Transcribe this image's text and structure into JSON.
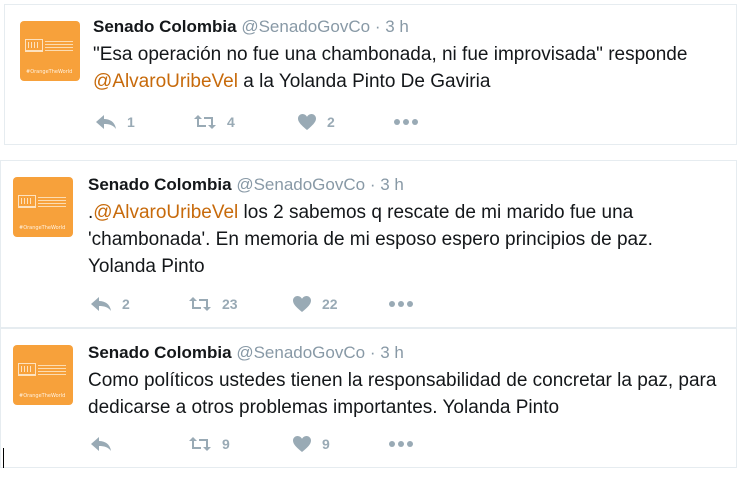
{
  "tweets": [
    {
      "name": "Senado Colombia",
      "handle": "@SenadoGovCo",
      "separator": "·",
      "time": "3 h",
      "avatar_tag": "#OrangeTheWorld",
      "text_before": "\"Esa operación no fue una chambonada, ni fue improvisada\" responde ",
      "mention": "@AlvaroUribeVel",
      "text_after": " a la  Yolanda Pinto De Gaviria",
      "replies": "1",
      "retweets": "4",
      "likes": "2"
    },
    {
      "name": "Senado Colombia",
      "handle": "@SenadoGovCo",
      "separator": "·",
      "time": "3 h",
      "avatar_tag": "#OrangeTheWorld",
      "text_before": ".",
      "mention": "@AlvaroUribeVel",
      "text_after": " los 2 sabemos q rescate de mi marido fue una 'chambonada'. En memoria de mi esposo espero principios de paz. Yolanda Pinto",
      "replies": "2",
      "retweets": "23",
      "likes": "22"
    },
    {
      "name": "Senado Colombia",
      "handle": "@SenadoGovCo",
      "separator": "·",
      "time": "3 h",
      "avatar_tag": "#OrangeTheWorld",
      "text_before": "Como políticos ustedes tienen la responsabilidad de concretar la paz, para dedicarse a otros problemas importantes. Yolanda Pinto",
      "mention": "",
      "text_after": "",
      "replies": "",
      "retweets": "9",
      "likes": "9"
    }
  ],
  "icons": [
    "reply-icon",
    "retweet-icon",
    "like-icon",
    "more-icon"
  ],
  "colors": {
    "avatar": "#f7a13b",
    "mention": "#c76a0b",
    "muted": "#8899a6",
    "action": "#99aab5"
  }
}
